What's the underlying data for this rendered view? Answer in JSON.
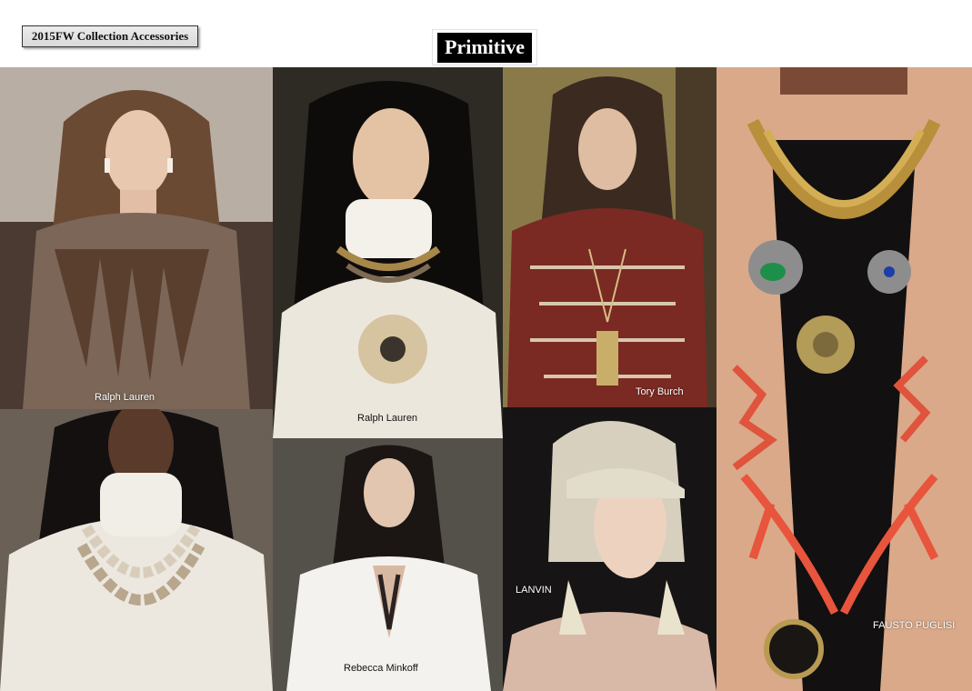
{
  "header": {
    "collection_label": "2015FW Collection Accessories",
    "theme_title": "Primitive"
  },
  "photos": [
    {
      "caption": "Ralph Lauren"
    },
    {
      "caption": "Ralph Lauren"
    },
    {
      "caption": "Tory Burch"
    },
    {
      "caption": ""
    },
    {
      "caption": ""
    },
    {
      "caption": "Rebecca Minkoff"
    },
    {
      "caption": "LANVIN"
    },
    {
      "caption": "FAUSTO PUGLISI"
    }
  ]
}
